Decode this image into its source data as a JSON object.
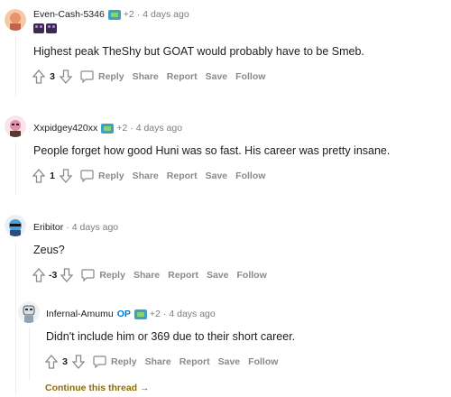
{
  "comments": [
    {
      "author": "Even-Cash-5346",
      "flair_count": "+2",
      "separator": "·",
      "time": "4 days ago",
      "text": "Highest peak TheShy but GOAT would probably have to be Smeb.",
      "votes": "3"
    },
    {
      "author": "Xxpidgey420xx",
      "flair_count": "+2",
      "separator": "·",
      "time": "4 days ago",
      "text": "People forget how good Huni was so fast. His career was pretty insane.",
      "votes": "1"
    },
    {
      "author": "Eribitor",
      "separator": "·",
      "time": "4 days ago",
      "text": "Zeus?",
      "votes": "-3"
    },
    {
      "author": "Infernal-Amumu",
      "op_label": "OP",
      "flair_count": "+2",
      "separator": "·",
      "time": "4 days ago",
      "text": "Didn't include him or 369 due to their short career.",
      "votes": "3"
    }
  ],
  "actions": {
    "reply": "Reply",
    "share": "Share",
    "report": "Report",
    "save": "Save",
    "follow": "Follow"
  },
  "continue_thread": "Continue this thread →",
  "colors": {
    "action_gray": "#878a8c",
    "op_blue": "#0079d3",
    "continue_gold": "#8a6d0b"
  }
}
